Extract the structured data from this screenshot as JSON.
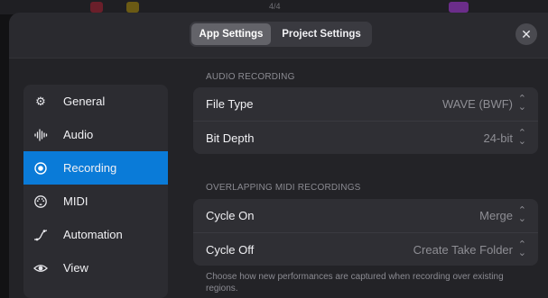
{
  "background": {
    "counter": "4/4"
  },
  "tabs": [
    {
      "label": "App Settings",
      "selected": true
    },
    {
      "label": "Project Settings",
      "selected": false
    }
  ],
  "close_glyph": "✕",
  "sidebar": {
    "items": [
      {
        "label": "General",
        "icon": "gear-icon",
        "glyph": "⚙"
      },
      {
        "label": "Audio",
        "icon": "waveform-icon",
        "glyph": ""
      },
      {
        "label": "Recording",
        "icon": "record-icon",
        "glyph": "⦿",
        "selected": true
      },
      {
        "label": "MIDI",
        "icon": "midi-port-icon",
        "glyph": ""
      },
      {
        "label": "Automation",
        "icon": "automation-curve-icon",
        "glyph": ""
      },
      {
        "label": "View",
        "icon": "eye-icon",
        "glyph": ""
      }
    ]
  },
  "sections": {
    "audio_recording": {
      "header": "AUDIO RECORDING",
      "rows": [
        {
          "label": "File Type",
          "value": "WAVE (BWF)"
        },
        {
          "label": "Bit Depth",
          "value": "24-bit"
        }
      ]
    },
    "overlapping_midi": {
      "header": "OVERLAPPING MIDI RECORDINGS",
      "rows": [
        {
          "label": "Cycle On",
          "value": "Merge"
        },
        {
          "label": "Cycle Off",
          "value": "Create Take Folder"
        }
      ],
      "footnote": "Choose how new performances are captured when recording over existing regions."
    }
  },
  "colors": {
    "accent": "#0a7bd8",
    "background": "#232327",
    "group": "#2f2f34",
    "secondary_text": "#8e8e94"
  }
}
